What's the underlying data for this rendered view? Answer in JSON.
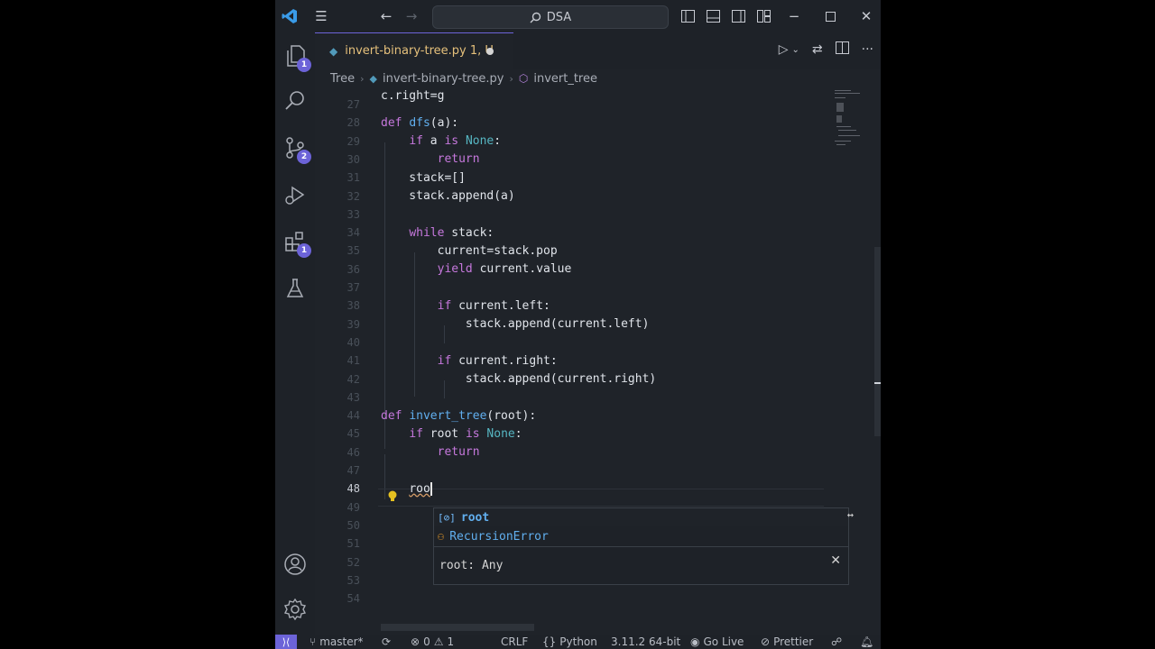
{
  "titlebar": {
    "search_text": "DSA"
  },
  "activity_badges": {
    "explorer": "1",
    "source_control": "2",
    "extensions": "1"
  },
  "tab": {
    "label": "invert-binary-tree.py 1, U"
  },
  "breadcrumb": {
    "folder": "Tree",
    "file": "invert-binary-tree.py",
    "symbol": "invert_tree"
  },
  "editor": {
    "line_numbers": [
      "27",
      "28",
      "29",
      "30",
      "31",
      "32",
      "33",
      "34",
      "35",
      "36",
      "37",
      "38",
      "39",
      "40",
      "41",
      "42",
      "43",
      "44",
      "45",
      "46",
      "47",
      "48",
      "49",
      "50",
      "51",
      "52",
      "53",
      "54"
    ],
    "top_partial": "c.right=g",
    "current_line_number": "48",
    "typed_text": "roo"
  },
  "suggest": {
    "items": [
      {
        "icon": "variable-icon",
        "match": "roo",
        "rest": "t",
        "label": "root"
      },
      {
        "icon": "class-icon",
        "match": "R",
        "label": "RecursionError"
      }
    ],
    "detail": "root: Any"
  },
  "status": {
    "branch": "master*",
    "errors": "0",
    "warnings": "1",
    "eol": "CRLF",
    "language": "Python",
    "interpreter": "3.11.2 64-bit",
    "golive": "Go Live",
    "prettier": "Prettier"
  },
  "colors": {
    "accent": "#6c63d8",
    "keyword": "#c678dd",
    "function": "#61afef",
    "constant": "#56b6c2",
    "tab_modified": "#e5c07b"
  }
}
